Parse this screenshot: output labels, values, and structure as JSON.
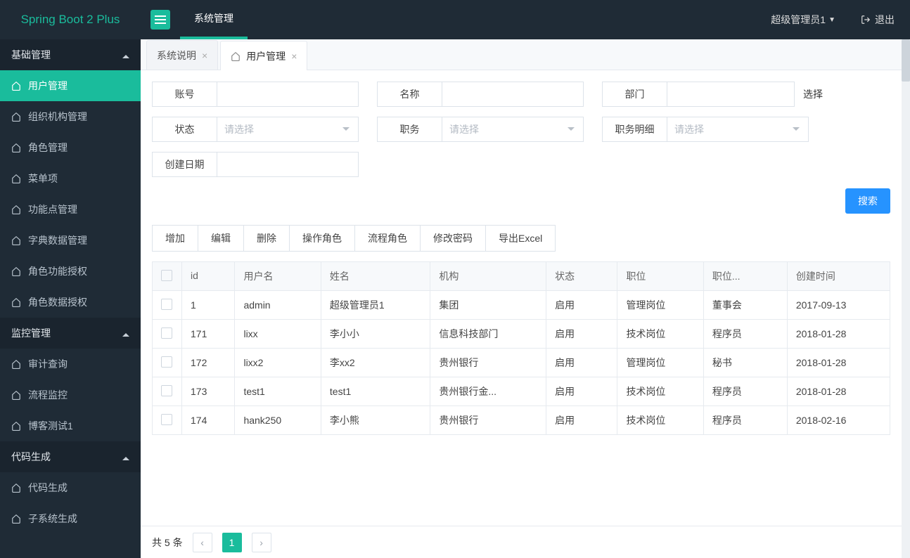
{
  "header": {
    "brand": "Spring Boot 2 Plus",
    "topTab": "系统管理",
    "user": "超级管理员1",
    "logout": "退出"
  },
  "sidebar": {
    "groups": [
      {
        "title": "基础管理",
        "items": [
          {
            "label": "用户管理",
            "active": true
          },
          {
            "label": "组织机构管理"
          },
          {
            "label": "角色管理"
          },
          {
            "label": "菜单项"
          },
          {
            "label": "功能点管理"
          },
          {
            "label": "字典数据管理"
          },
          {
            "label": "角色功能授权"
          },
          {
            "label": "角色数据授权"
          }
        ]
      },
      {
        "title": "监控管理",
        "items": [
          {
            "label": "审计查询"
          },
          {
            "label": "流程监控"
          },
          {
            "label": "博客测试1"
          }
        ]
      },
      {
        "title": "代码生成",
        "items": [
          {
            "label": "代码生成"
          },
          {
            "label": "子系统生成"
          }
        ]
      }
    ]
  },
  "tabs": [
    {
      "label": "系统说明"
    },
    {
      "label": "用户管理",
      "active": true,
      "icon": true
    }
  ],
  "filters": {
    "account": "账号",
    "name": "名称",
    "dept": "部门",
    "deptSelect": "选择",
    "status": "状态",
    "job": "职务",
    "jobDetail": "职务明细",
    "createDate": "创建日期",
    "placeholder": "请选择"
  },
  "buttons": {
    "search": "搜索",
    "toolbar": [
      "增加",
      "编辑",
      "删除",
      "操作角色",
      "流程角色",
      "修改密码",
      "导出Excel"
    ]
  },
  "table": {
    "cols": [
      "id",
      "用户名",
      "姓名",
      "机构",
      "状态",
      "职位",
      "职位...",
      "创建时间"
    ],
    "rows": [
      {
        "id": "1",
        "user": "admin",
        "name": "超级管理员1",
        "org": "集团",
        "status": "启用",
        "pos": "管理岗位",
        "pos2": "董事会",
        "date": "2017-09-13"
      },
      {
        "id": "171",
        "user": "lixx",
        "name": "李小小",
        "org": "信息科技部门",
        "status": "启用",
        "pos": "技术岗位",
        "pos2": "程序员",
        "date": "2018-01-28"
      },
      {
        "id": "172",
        "user": "lixx2",
        "name": "李xx2",
        "org": "贵州银行",
        "status": "启用",
        "pos": "管理岗位",
        "pos2": "秘书",
        "date": "2018-01-28"
      },
      {
        "id": "173",
        "user": "test1",
        "name": "test1",
        "org": "贵州银行金...",
        "status": "启用",
        "pos": "技术岗位",
        "pos2": "程序员",
        "date": "2018-01-28"
      },
      {
        "id": "174",
        "user": "hank250",
        "name": "李小熊",
        "org": "贵州银行",
        "status": "启用",
        "pos": "技术岗位",
        "pos2": "程序员",
        "date": "2018-02-16"
      }
    ]
  },
  "pager": {
    "total": "共 5 条",
    "page": "1"
  }
}
